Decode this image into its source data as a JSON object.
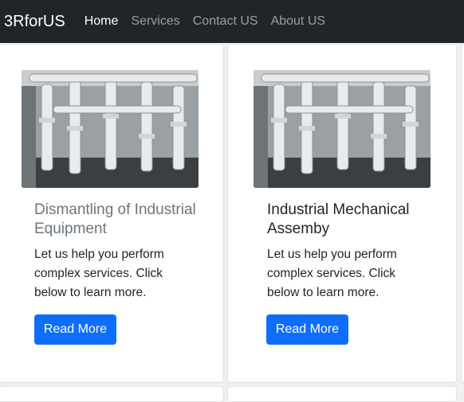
{
  "navbar": {
    "brand": "3RforUS",
    "links": [
      {
        "label": "Home",
        "active": true
      },
      {
        "label": "Services",
        "active": false
      },
      {
        "label": "Contact US",
        "active": false
      },
      {
        "label": "About US",
        "active": false
      }
    ]
  },
  "cards": [
    {
      "title": "Dismantling of Industrial Equipment",
      "text": "Let us help you perform complex services. Click below to learn more.",
      "button": "Read More",
      "title_color": "#6c757d",
      "image": "industrial-pipes-photo"
    },
    {
      "title": "Industrial Mechanical Assemby",
      "text": "Let us help you perform complex services. Click below to learn more.",
      "button": "Read More",
      "title_color": "#212529",
      "image": "industrial-pipes-photo"
    }
  ],
  "colors": {
    "navbar_bg": "#212529",
    "button_bg": "#0d6efd"
  }
}
